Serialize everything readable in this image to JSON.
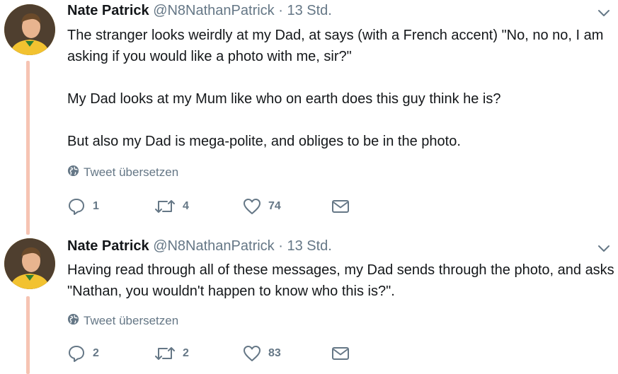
{
  "tweets": [
    {
      "name": "Nate Patrick",
      "handle": "@N8NathanPatrick",
      "separator": "·",
      "time": "13 Std.",
      "paragraphs": [
        "The stranger looks weirdly at my Dad, at says (with a French accent) \"No, no no, I am asking if you would like a photo with me, sir?\"",
        "My Dad looks at my Mum like who on earth does this guy think he is?",
        "But also my Dad is mega-polite, and obliges to be in the photo."
      ],
      "translate_label": "Tweet übersetzen",
      "replies": "1",
      "retweets": "4",
      "likes": "74"
    },
    {
      "name": "Nate Patrick",
      "handle": "@N8NathanPatrick",
      "separator": "·",
      "time": "13 Std.",
      "paragraphs": [
        "Having read through all of these messages, my Dad sends through the photo, and asks \"Nathan, you wouldn't happen to know who this is?\"."
      ],
      "translate_label": "Tweet übersetzen",
      "replies": "2",
      "retweets": "2",
      "likes": "83"
    }
  ],
  "icons": {
    "reply": "reply-icon",
    "retweet": "retweet-icon",
    "like": "heart-icon",
    "message": "envelope-icon",
    "globe": "globe-icon",
    "caret": "chevron-down-icon"
  },
  "colors": {
    "thread_line": "#f6c4b3",
    "secondary_text": "#657786",
    "avatar_jersey": "#f2c230"
  }
}
